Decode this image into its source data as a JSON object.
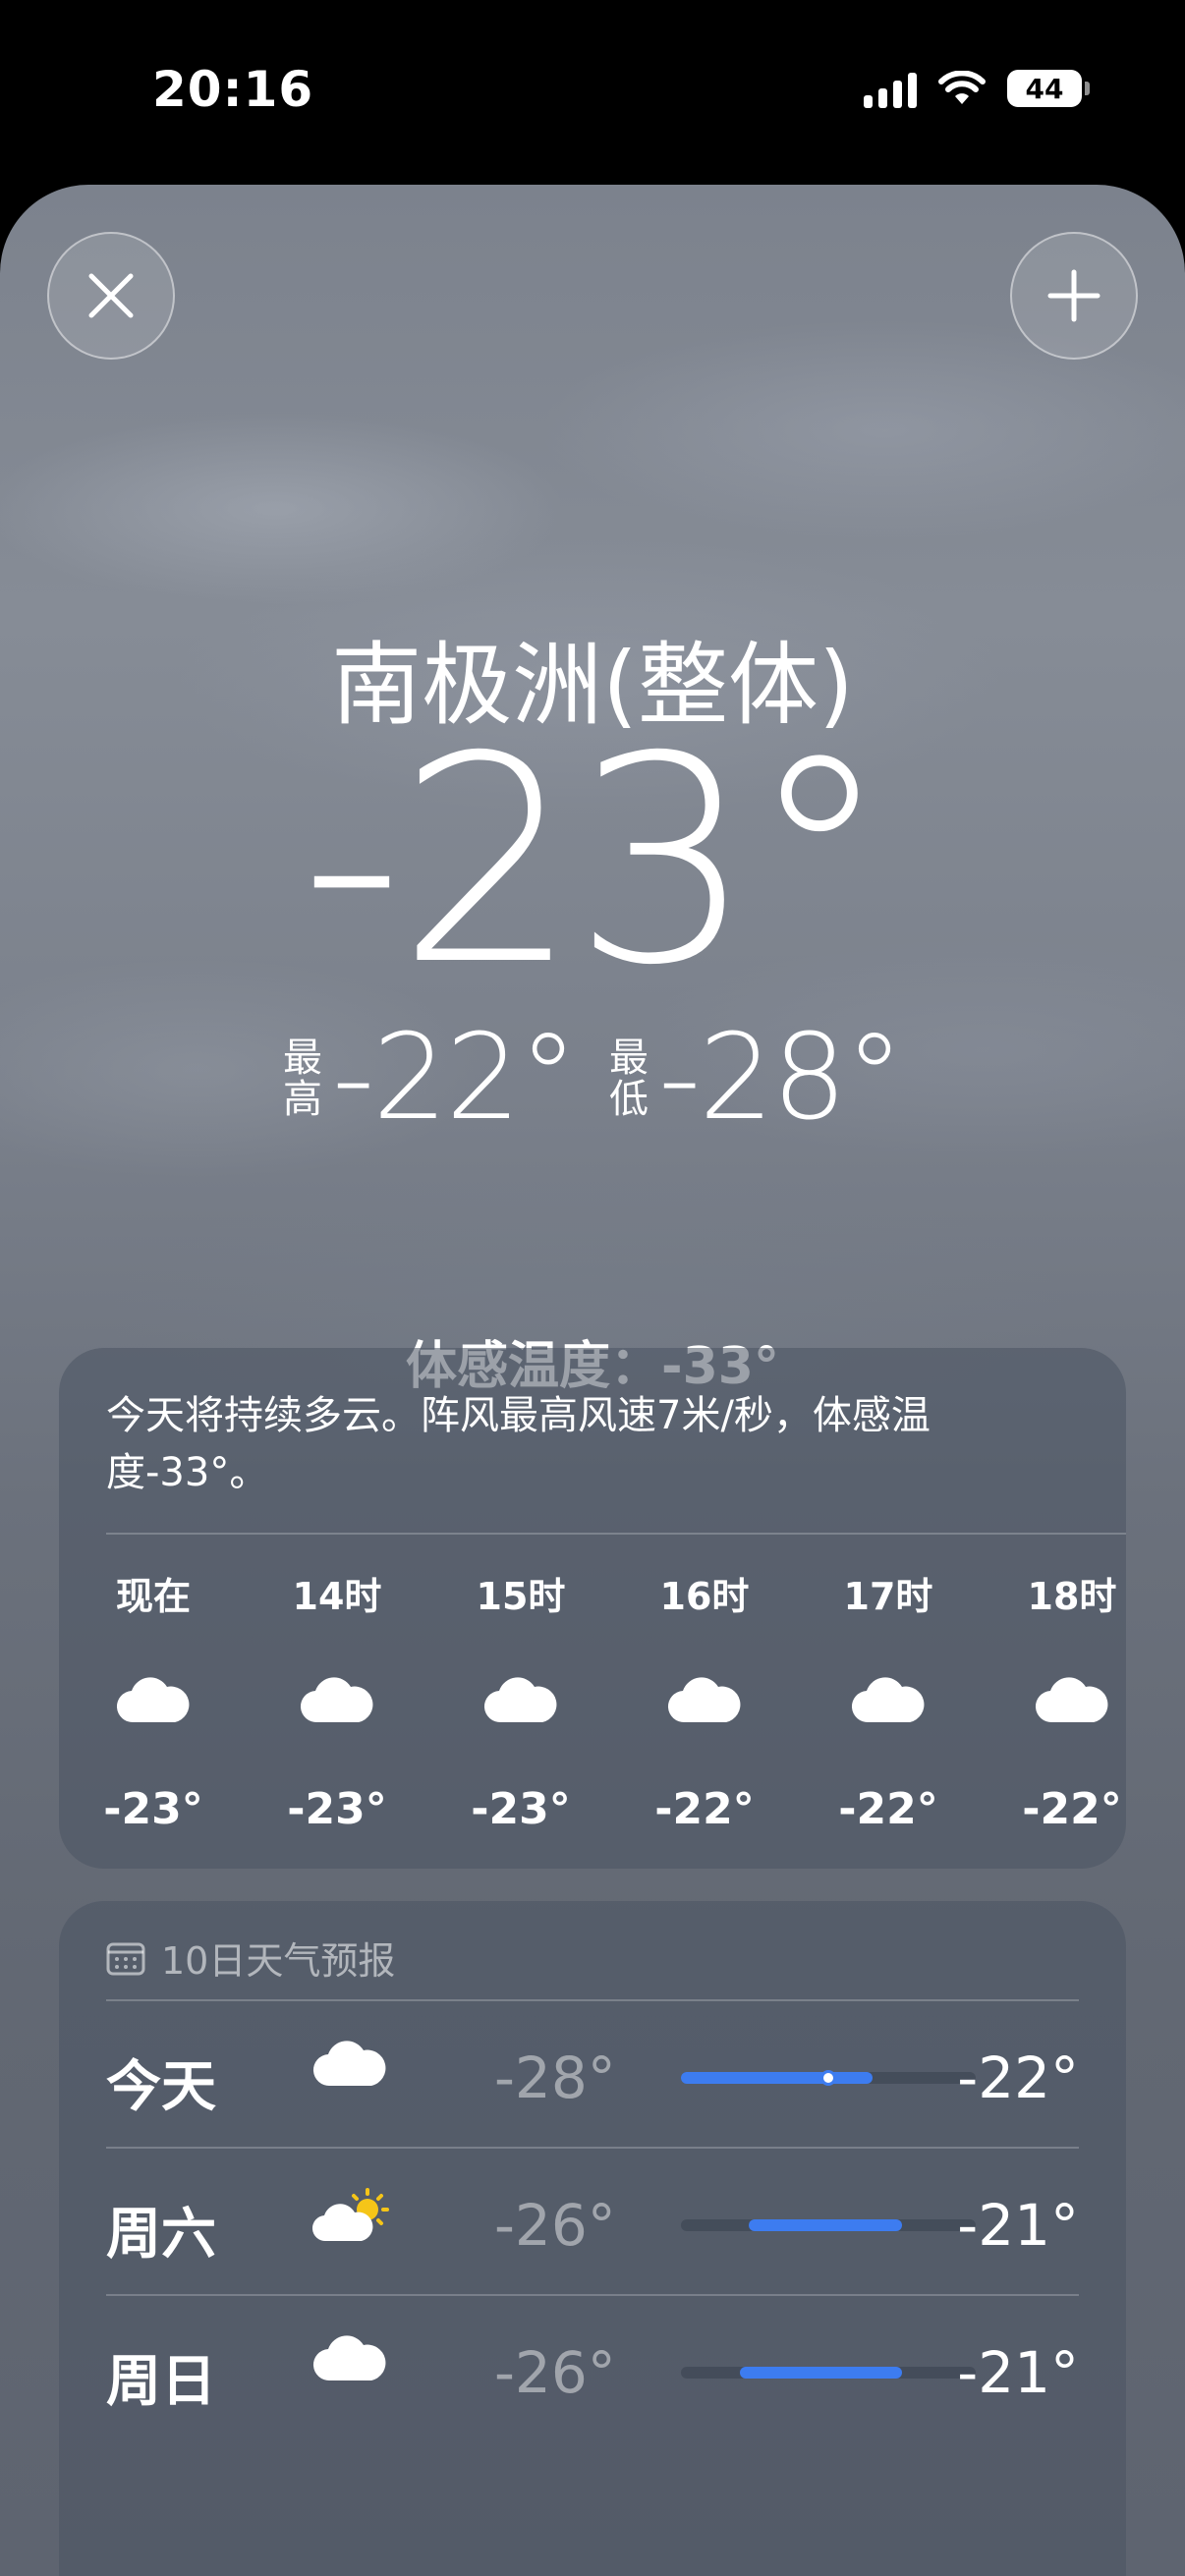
{
  "status_bar": {
    "time": "20:16",
    "battery": "44",
    "icons": [
      "signal-icon",
      "wifi-icon",
      "battery-icon"
    ]
  },
  "sheet": {
    "close_icon": "close-icon",
    "add_icon": "plus-icon"
  },
  "current": {
    "location": "南极洲(整体)",
    "temperature": "-23°",
    "high_label_1": "最",
    "high_label_2": "高",
    "high": "-22°",
    "low_label_1": "最",
    "low_label_2": "低",
    "low": "-28°",
    "feels_like": "体感温度：-33°"
  },
  "hourly": {
    "summary": "今天将持续多云。阵风最高风速7米/秒，体感温度-33°。",
    "items": [
      {
        "label": "现在",
        "icon": "cloud-icon",
        "temp": "-23°"
      },
      {
        "label": "14时",
        "icon": "cloud-icon",
        "temp": "-23°"
      },
      {
        "label": "15时",
        "icon": "cloud-icon",
        "temp": "-23°"
      },
      {
        "label": "16时",
        "icon": "cloud-icon",
        "temp": "-22°"
      },
      {
        "label": "17时",
        "icon": "cloud-icon",
        "temp": "-22°"
      },
      {
        "label": "18时",
        "icon": "cloud-icon",
        "temp": "-22°"
      }
    ]
  },
  "daily": {
    "header": "10日天气预报",
    "header_icon": "calendar-icon",
    "days": [
      {
        "name": "今天",
        "icon": "cloud-icon",
        "low": "-28°",
        "high": "-22°",
        "range_start": 0.0,
        "range_end": 0.65,
        "current": 0.5
      },
      {
        "name": "周六",
        "icon": "partly-sunny-icon",
        "low": "-26°",
        "high": "-21°",
        "range_start": 0.23,
        "range_end": 0.75
      },
      {
        "name": "周日",
        "icon": "cloud-icon",
        "low": "-26°",
        "high": "-21°",
        "range_start": 0.2,
        "range_end": 0.75
      }
    ]
  },
  "colors": {
    "range_bar": "#3d7cf0",
    "sun": "#f5c518"
  }
}
